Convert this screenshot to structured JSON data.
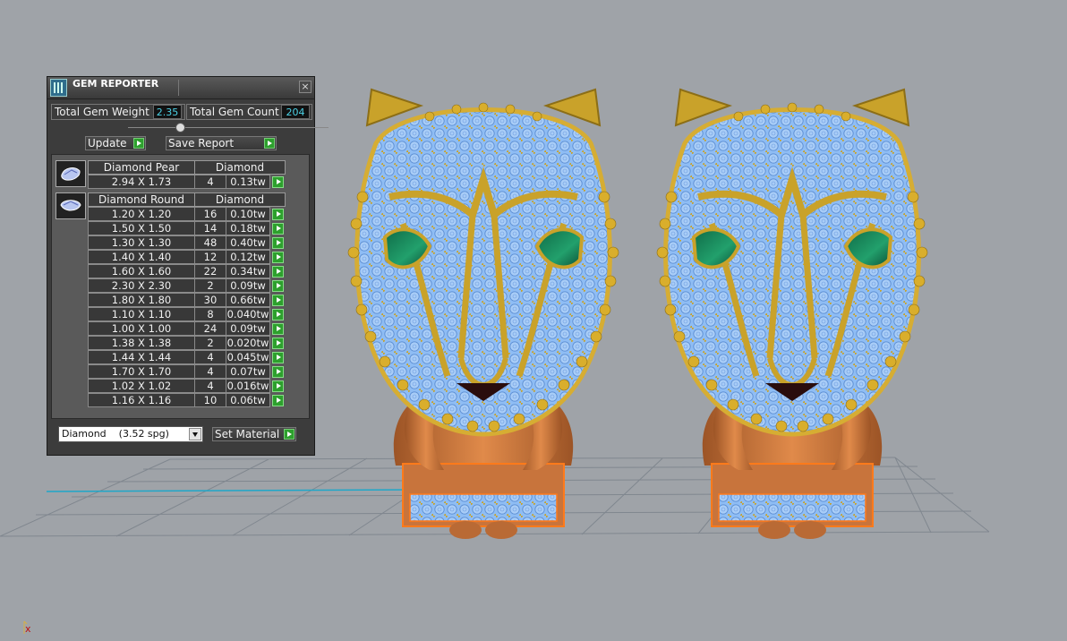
{
  "panel": {
    "title": "GEM REPORTER",
    "close_glyph": "×",
    "total_weight_label": "Total Gem Weight",
    "total_weight_value": "2.35",
    "total_count_label": "Total Gem Count",
    "total_count_value": "204",
    "update_label": "Update",
    "save_report_label": "Save Report",
    "groups": [
      {
        "shape": "Diamond Pear",
        "material": "Diamond",
        "rows": [
          {
            "size": "2.94 X 1.73",
            "count": "4",
            "weight": "0.13tw"
          }
        ]
      },
      {
        "shape": "Diamond Round",
        "material": "Diamond",
        "rows": [
          {
            "size": "1.20 X 1.20",
            "count": "16",
            "weight": "0.10tw"
          },
          {
            "size": "1.50 X 1.50",
            "count": "14",
            "weight": "0.18tw"
          },
          {
            "size": "1.30 X 1.30",
            "count": "48",
            "weight": "0.40tw"
          },
          {
            "size": "1.40 X 1.40",
            "count": "12",
            "weight": "0.12tw"
          },
          {
            "size": "1.60 X 1.60",
            "count": "22",
            "weight": "0.34tw"
          },
          {
            "size": "2.30 X 2.30",
            "count": "2",
            "weight": "0.09tw"
          },
          {
            "size": "1.80 X 1.80",
            "count": "30",
            "weight": "0.66tw"
          },
          {
            "size": "1.10 X 1.10",
            "count": "8",
            "weight": "0.040tw"
          },
          {
            "size": "1.00 X 1.00",
            "count": "24",
            "weight": "0.09tw"
          },
          {
            "size": "1.38 X 1.38",
            "count": "2",
            "weight": "0.020tw"
          },
          {
            "size": "1.44 X 1.44",
            "count": "4",
            "weight": "0.045tw"
          },
          {
            "size": "1.70 X 1.70",
            "count": "4",
            "weight": "0.07tw"
          },
          {
            "size": "1.02 X 1.02",
            "count": "4",
            "weight": "0.016tw"
          },
          {
            "size": "1.16 X 1.16",
            "count": "10",
            "weight": "0.06tw"
          }
        ]
      }
    ],
    "material_select": "Diamond    (3.52 spg)",
    "set_material_label": "Set Material"
  },
  "viewport": {
    "axis_x_label": "x",
    "colors": {
      "background": "#9fa3a8",
      "gold": "#c9a22a",
      "stones": "#8fbdf4",
      "eyes": "#1d8a5e",
      "copper": "#c8743c",
      "selection": "#ff7a1a"
    },
    "models": [
      "panther-ring-left",
      "panther-ring-right"
    ]
  },
  "icons": [
    "app-icon",
    "close-icon",
    "gem-pear-icon",
    "gem-round-icon",
    "play-icon",
    "dropdown-arrow-icon"
  ]
}
